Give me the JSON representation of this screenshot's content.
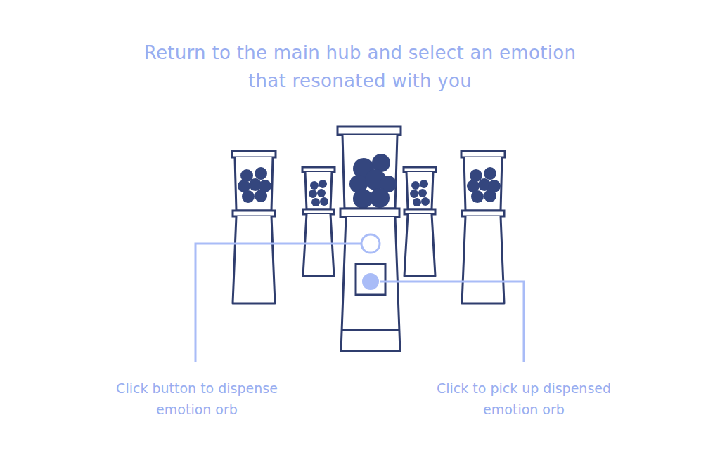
{
  "instruction": {
    "lines": [
      "Return to the main hub and select an emotion",
      "that resonated with you"
    ]
  },
  "dispenser": {
    "dispensed": true
  },
  "callouts": [
    {
      "lines": [
        "Click button to dispense",
        "emotion orb"
      ]
    },
    {
      "lines": [
        "Click to pick up dispensed",
        "emotion orb"
      ]
    }
  ]
}
